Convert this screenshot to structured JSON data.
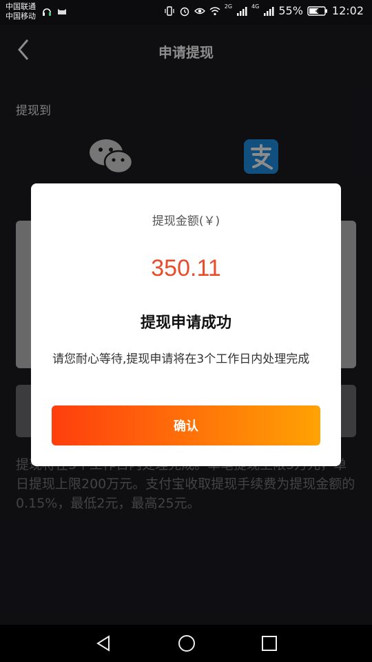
{
  "status_bar": {
    "carrier1": "中国联通",
    "carrier2": "中国移动",
    "network1": "2G",
    "network2": "4G",
    "battery": "55%",
    "time": "12:02"
  },
  "header": {
    "title": "申请提现"
  },
  "withdraw_to_label": "提现到",
  "notice": "提现将在3个工作日内处理完成。单笔提现上限5万元，单日提现上限200万元。支付宝收取提现手续费为提现金额的0.15%，最低2元，最高25元。",
  "modal": {
    "amount_label": "提现金额(￥)",
    "amount": "350.11",
    "status": "提现申请成功",
    "description": "请您耐心等待,提现申请将在3个工作日内处理完成",
    "confirm_label": "确认"
  },
  "colors": {
    "accent_start": "#ff3e0e",
    "accent_end": "#ffa204",
    "amount": "#e84c2b"
  }
}
